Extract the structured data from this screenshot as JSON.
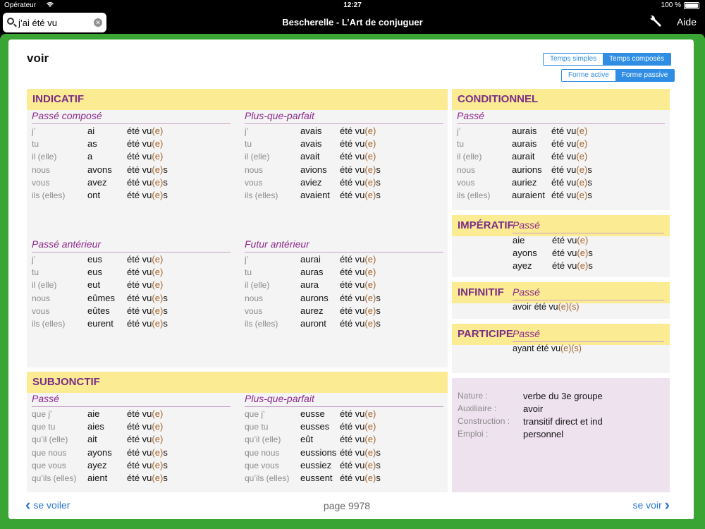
{
  "status": {
    "carrier": "Opérateur",
    "time": "12:27",
    "battery": "100 %"
  },
  "nav": {
    "search_value": "j’ai été vu",
    "title": "Bescherelle - L’Art de conjuguer",
    "help": "Aide"
  },
  "verb": "voir",
  "toggles": {
    "temps_simples": "Temps simples",
    "temps_composes": "Temps composés",
    "forme_active": "Forme active",
    "forme_passive": "Forme passive"
  },
  "indicatif": {
    "title": "INDICATIF",
    "passe_compose": {
      "name": "Passé composé",
      "rows": [
        [
          "j’",
          "ai",
          "été vu",
          "(e)",
          ""
        ],
        [
          "tu",
          "as",
          "été vu",
          "(e)",
          ""
        ],
        [
          "il (elle)",
          "a",
          "été vu",
          "(e)",
          ""
        ],
        [
          "nous",
          "avons",
          "été vu",
          "(e)",
          "s"
        ],
        [
          "vous",
          "avez",
          "été vu",
          "(e)",
          "s"
        ],
        [
          "ils (elles)",
          "ont",
          "été vu",
          "(e)",
          "s"
        ]
      ]
    },
    "plus_que_parfait": {
      "name": "Plus-que-parfait",
      "rows": [
        [
          "j’",
          "avais",
          "été vu",
          "(e)",
          ""
        ],
        [
          "tu",
          "avais",
          "été vu",
          "(e)",
          ""
        ],
        [
          "il (elle)",
          "avait",
          "été vu",
          "(e)",
          ""
        ],
        [
          "nous",
          "avions",
          "été vu",
          "(e)",
          "s"
        ],
        [
          "vous",
          "aviez",
          "été vu",
          "(e)",
          "s"
        ],
        [
          "ils (elles)",
          "avaient",
          "été vu",
          "(e)",
          "s"
        ]
      ]
    },
    "passe_anterieur": {
      "name": "Passé antérieur",
      "rows": [
        [
          "j’",
          "eus",
          "été vu",
          "(e)",
          ""
        ],
        [
          "tu",
          "eus",
          "été vu",
          "(e)",
          ""
        ],
        [
          "il (elle)",
          "eut",
          "été vu",
          "(e)",
          ""
        ],
        [
          "nous",
          "eûmes",
          "été vu",
          "(e)",
          "s"
        ],
        [
          "vous",
          "eûtes",
          "été vu",
          "(e)",
          "s"
        ],
        [
          "ils (elles)",
          "eurent",
          "été vu",
          "(e)",
          "s"
        ]
      ]
    },
    "futur_anterieur": {
      "name": "Futur antérieur",
      "rows": [
        [
          "j’",
          "aurai",
          "été vu",
          "(e)",
          ""
        ],
        [
          "tu",
          "auras",
          "été vu",
          "(e)",
          ""
        ],
        [
          "il (elle)",
          "aura",
          "été vu",
          "(e)",
          ""
        ],
        [
          "nous",
          "aurons",
          "été vu",
          "(e)",
          "s"
        ],
        [
          "vous",
          "aurez",
          "été vu",
          "(e)",
          "s"
        ],
        [
          "ils (elles)",
          "auront",
          "été vu",
          "(e)",
          "s"
        ]
      ]
    }
  },
  "subjonctif": {
    "title": "SUBJONCTIF",
    "passe": {
      "name": "Passé",
      "rows": [
        [
          "que j’",
          "aie",
          "été vu",
          "(e)",
          ""
        ],
        [
          "que tu",
          "aies",
          "été vu",
          "(e)",
          ""
        ],
        [
          "qu’il (elle)",
          "ait",
          "été vu",
          "(e)",
          ""
        ],
        [
          "que nous",
          "ayons",
          "été vu",
          "(e)",
          "s"
        ],
        [
          "que vous",
          "ayez",
          "été vu",
          "(e)",
          "s"
        ],
        [
          "qu’ils (elles)",
          "aient",
          "été vu",
          "(e)",
          "s"
        ]
      ]
    },
    "plus_que_parfait": {
      "name": "Plus-que-parfait",
      "rows": [
        [
          "que j’",
          "eusse",
          "été vu",
          "(e)",
          ""
        ],
        [
          "que tu",
          "eusses",
          "été vu",
          "(e)",
          ""
        ],
        [
          "qu’il (elle)",
          "eût",
          "été vu",
          "(e)",
          ""
        ],
        [
          "que nous",
          "eussions",
          "été vu",
          "(e)",
          "s"
        ],
        [
          "que vous",
          "eussiez",
          "été vu",
          "(e)",
          "s"
        ],
        [
          "qu’ils (elles)",
          "eussent",
          "été vu",
          "(e)",
          "s"
        ]
      ]
    }
  },
  "conditionnel": {
    "title": "CONDITIONNEL",
    "passe": {
      "name": "Passé",
      "rows": [
        [
          "j’",
          "aurais",
          "été vu",
          "(e)",
          ""
        ],
        [
          "tu",
          "aurais",
          "été vu",
          "(e)",
          ""
        ],
        [
          "il (elle)",
          "aurait",
          "été vu",
          "(e)",
          ""
        ],
        [
          "nous",
          "aurions",
          "été vu",
          "(e)",
          "s"
        ],
        [
          "vous",
          "auriez",
          "été vu",
          "(e)",
          "s"
        ],
        [
          "ils (elles)",
          "auraient",
          "été vu",
          "(e)",
          "s"
        ]
      ]
    }
  },
  "imperatif": {
    "title": "IMPÉRATIF",
    "tense": "Passé",
    "rows": [
      [
        "aie",
        "été vu",
        "(e)",
        ""
      ],
      [
        "ayons",
        "été vu",
        "(e)",
        "s"
      ],
      [
        "ayez",
        "été vu",
        "(e)",
        "s"
      ]
    ]
  },
  "infinitif": {
    "title": "INFINITIF",
    "tense": "Passé",
    "value": "avoir été vu",
    "suffix": "(e)(s)"
  },
  "participe": {
    "title": "PARTICIPE",
    "tense": "Passé",
    "value": "ayant été vu",
    "suffix": "(e)(s)"
  },
  "info": {
    "nature_label": "Nature :",
    "nature": "verbe du 3e groupe",
    "auxiliaire_label": "Auxiliaire :",
    "auxiliaire": "avoir",
    "construction_label": "Construction :",
    "construction": "transitif direct et ind",
    "emploi_label": "Emploi :",
    "emploi": "personnel"
  },
  "footer": {
    "prev": "se voiler",
    "page": "page 9978",
    "next": "se voir"
  }
}
